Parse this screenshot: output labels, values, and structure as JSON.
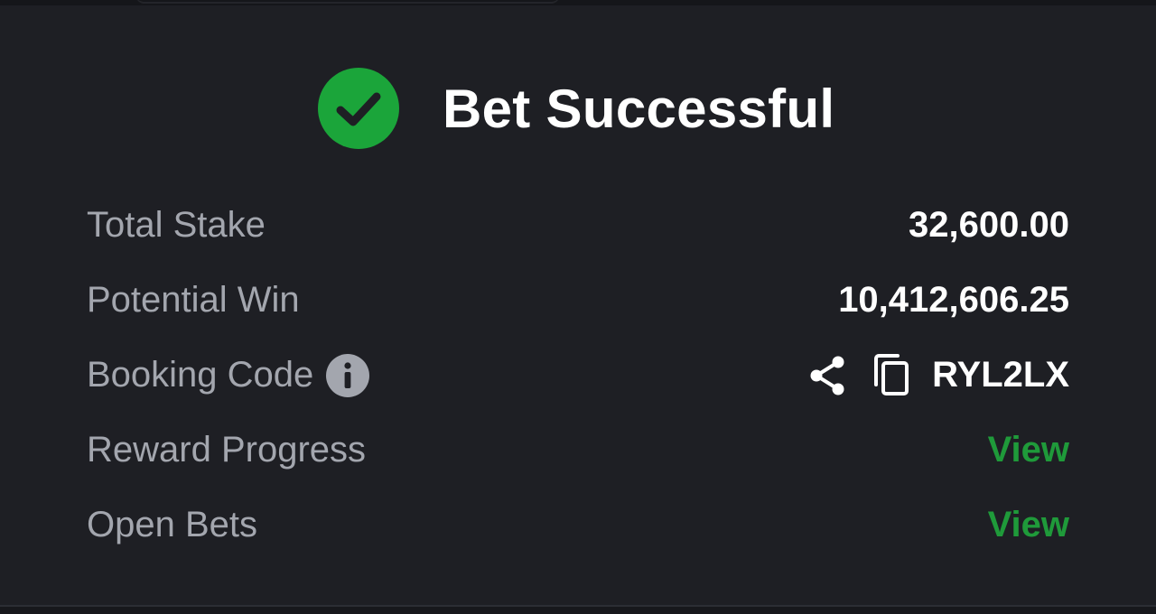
{
  "header": {
    "title": "Bet Successful"
  },
  "summary": {
    "total_stake_label": "Total Stake",
    "total_stake_value": "32,600.00",
    "potential_win_label": "Potential Win",
    "potential_win_value": "10,412,606.25",
    "booking_code_label": "Booking Code",
    "booking_code_value": "RYL2LX",
    "reward_progress_label": "Reward Progress",
    "reward_progress_link": "View",
    "open_bets_label": "Open Bets",
    "open_bets_link": "View"
  },
  "icons": {
    "success": "check-circle-icon",
    "info": "info-icon",
    "share": "share-icon",
    "copy": "copy-icon"
  },
  "colors": {
    "background": "#1e1f24",
    "success_green": "#1ba53a",
    "link_green": "#1f9a3a",
    "label_gray": "#a3a6ae",
    "value_white": "#ffffff"
  }
}
